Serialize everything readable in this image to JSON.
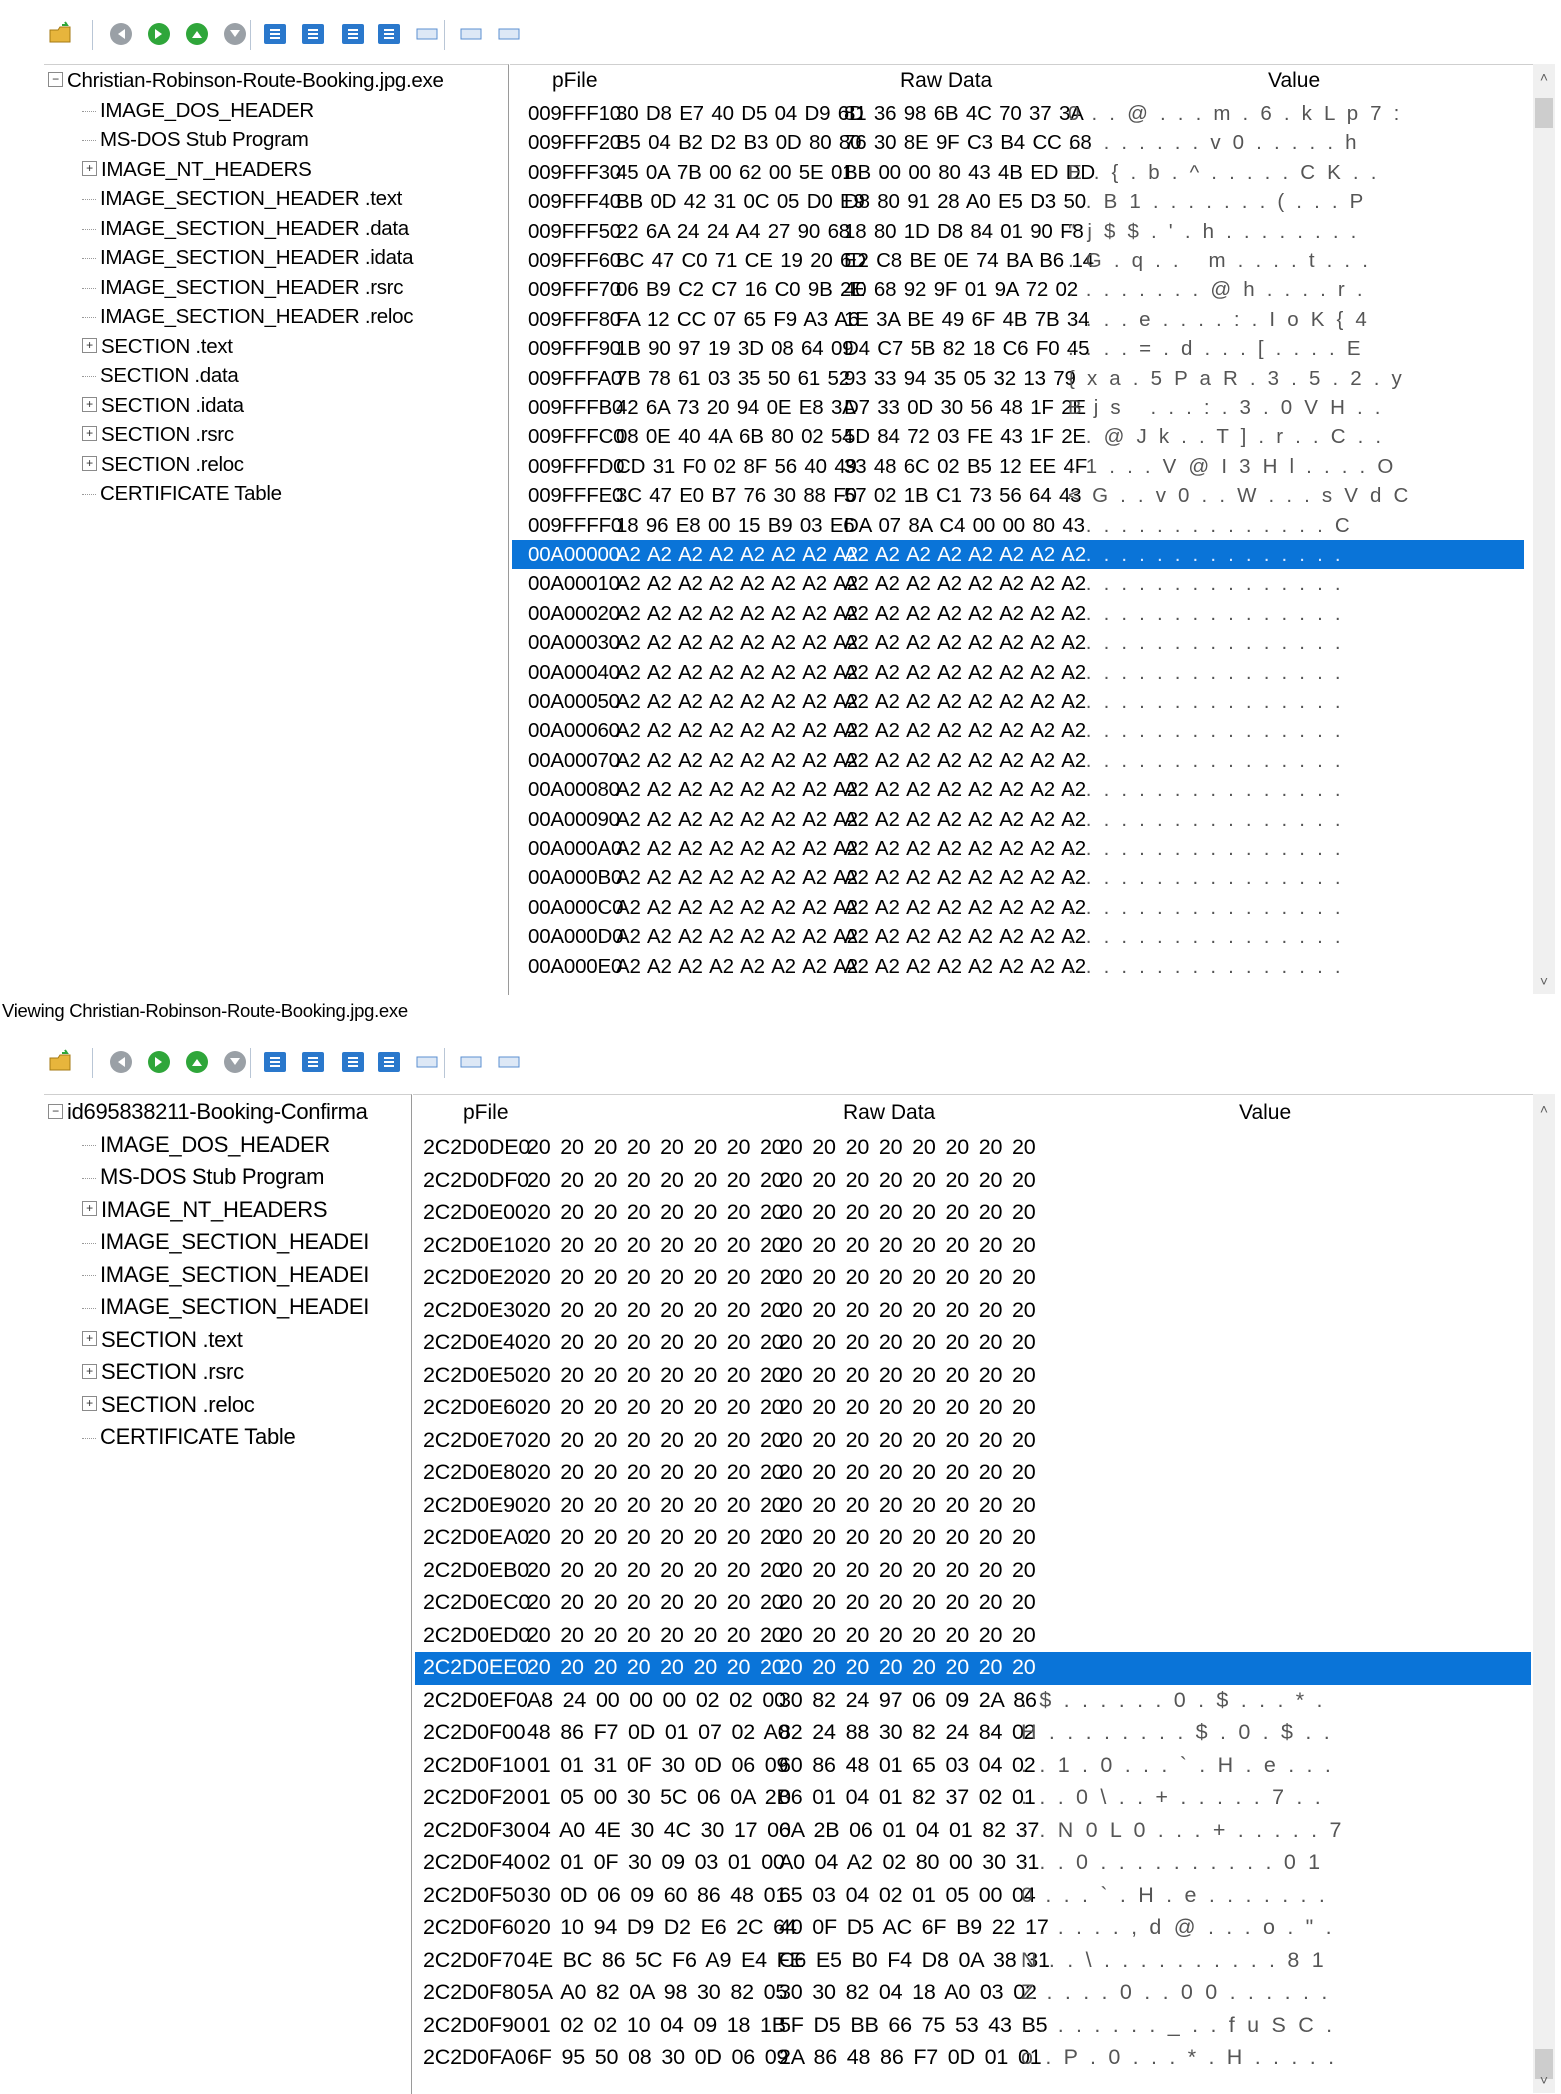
{
  "toolbar_icons": [
    {
      "name": "open-file-icon",
      "glyph": "📂"
    },
    {
      "name": "back-icon",
      "glyph": "◀"
    },
    {
      "name": "forward-icon",
      "glyph": "▶"
    },
    {
      "name": "up-icon",
      "glyph": "▲"
    },
    {
      "name": "down-icon",
      "glyph": "▼"
    },
    {
      "name": "hex-view-icon",
      "glyph": "▣"
    },
    {
      "name": "mode-icon",
      "glyph": "▤"
    },
    {
      "name": "export-icon",
      "glyph": "⇲"
    },
    {
      "name": "save-icon",
      "glyph": "⤓"
    },
    {
      "name": "view-wide-icon",
      "glyph": "▭"
    },
    {
      "name": "view-medium-icon",
      "glyph": "▭"
    },
    {
      "name": "view-narrow-icon",
      "glyph": "▭"
    }
  ],
  "colors": {
    "selection": "#0a74d8",
    "toolbar_blue": "#2a78cc",
    "toolbar_green": "#2fa63a"
  },
  "pane1": {
    "tree": [
      {
        "label": "Christian-Robinson-Route-Booking.jpg.exe",
        "expander": "−",
        "level": 0
      },
      {
        "label": "IMAGE_DOS_HEADER",
        "expander": "",
        "level": 1
      },
      {
        "label": "MS-DOS Stub Program",
        "expander": "",
        "level": 1
      },
      {
        "label": "IMAGE_NT_HEADERS",
        "expander": "+",
        "level": 1
      },
      {
        "label": "IMAGE_SECTION_HEADER .text",
        "expander": "",
        "level": 1
      },
      {
        "label": "IMAGE_SECTION_HEADER .data",
        "expander": "",
        "level": 1
      },
      {
        "label": "IMAGE_SECTION_HEADER .idata",
        "expander": "",
        "level": 1
      },
      {
        "label": "IMAGE_SECTION_HEADER .rsrc",
        "expander": "",
        "level": 1
      },
      {
        "label": "IMAGE_SECTION_HEADER .reloc",
        "expander": "",
        "level": 1
      },
      {
        "label": "SECTION .text",
        "expander": "+",
        "level": 1
      },
      {
        "label": "SECTION .data",
        "expander": "",
        "level": 1
      },
      {
        "label": "SECTION .idata",
        "expander": "+",
        "level": 1
      },
      {
        "label": "SECTION .rsrc",
        "expander": "+",
        "level": 1
      },
      {
        "label": "SECTION .reloc",
        "expander": "+",
        "level": 1
      },
      {
        "label": "CERTIFICATE Table",
        "expander": "",
        "level": 1
      }
    ],
    "headers": {
      "pfile": "pFile",
      "raw": "Raw Data",
      "value": "Value"
    },
    "rows": [
      {
        "addr": "009FFF10",
        "a": "30 D8 E7 40 D5 04 D9 6D",
        "b": "81 36 98 6B 4C 70 37 3A",
        "v": "0 . . @ . . . m . 6 . k L p 7 :"
      },
      {
        "addr": "009FFF20",
        "a": "B5 04 B2 D2 B3 0D 80 80",
        "b": "76 30 8E 9F C3 B4 CC 68",
        "v": ". . . . . . . . v 0 . . . . . h"
      },
      {
        "addr": "009FFF30",
        "a": "45 0A 7B 00 62 00 5E 01",
        "b": "BB 00 00 80 43 4B ED DD",
        "v": "E . { . b . ^ . . . . . C K . ."
      },
      {
        "addr": "009FFF40",
        "a": "BB 0D 42 31 0C 05 D0 E9",
        "b": "D8 80 91 28 A0 E5 D3 50",
        "v": ". . B 1 . . . . . . . ( . . . P"
      },
      {
        "addr": "009FFF50",
        "a": "22 6A 24 24 A4 27 90 68",
        "b": "18 80 1D D8 84 01 90 F8",
        "v": "\" j $ $ . ' . h . . . . . . . ."
      },
      {
        "addr": "009FFF60",
        "a": "BC 47 C0 71 CE 19 20 6D",
        "b": "E2 C8 BE 0E 74 BA B6 14",
        "v": ". G . q . .   m . . . . t . . ."
      },
      {
        "addr": "009FFF70",
        "a": "06 B9 C2 C7 16 C0 9B 2E",
        "b": "40 68 92 9F 01 9A 72 02",
        "v": ". . . . . . . . @ h . . . . r ."
      },
      {
        "addr": "009FFF80",
        "a": "FA 12 CC 07 65 F9 A3 A6",
        "b": "1E 3A BE 49 6F 4B 7B 34",
        "v": ". . . . e . . . . : . I o K { 4"
      },
      {
        "addr": "009FFF90",
        "a": "1B 90 97 19 3D 08 64 09",
        "b": "D4 C7 5B 82 18 C6 F0 45",
        "v": ". . . . = . d . . . [ . . . . E"
      },
      {
        "addr": "009FFFA0",
        "a": "7B 78 61 03 35 50 61 52",
        "b": "93 33 94 35 05 32 13 79",
        "v": "{ x a . 5 P a R . 3 . 5 . 2 . y"
      },
      {
        "addr": "009FFFB0",
        "a": "42 6A 73 20 94 0E E8 3A",
        "b": "D7 33 0D 30 56 48 1F 2E",
        "v": "B j s   . . . : . 3 . 0 V H . ."
      },
      {
        "addr": "009FFFC0",
        "a": "08 0E 40 4A 6B 80 02 54",
        "b": "5D 84 72 03 FE 43 1F 2E",
        "v": ". . @ J k . . T ] . r . . C . ."
      },
      {
        "addr": "009FFFD0",
        "a": "CD 31 F0 02 8F 56 40 49",
        "b": "33 48 6C 02 B5 12 EE 4F",
        "v": ". 1 . . . V @ I 3 H l . . . . O"
      },
      {
        "addr": "009FFFE0",
        "a": "3C 47 E0 B7 76 30 88 F0",
        "b": "57 02 1B C1 73 56 64 43",
        "v": "< G . . v 0 . . W . . . s V d C"
      },
      {
        "addr": "009FFFF0",
        "a": "18 96 E8 00 15 B9 03 E6",
        "b": "DA 07 8A C4 00 00 80 43",
        "v": ". . . . . . . . . . . . . . . C"
      },
      {
        "addr": "00A00000",
        "a": "A2 A2 A2 A2 A2 A2 A2 A2",
        "b": "A2 A2 A2 A2 A2 A2 A2 A2",
        "v": ". . . . . . . . . . . . . . . .",
        "selected": true
      },
      {
        "addr": "00A00010",
        "a": "A2 A2 A2 A2 A2 A2 A2 A2",
        "b": "A2 A2 A2 A2 A2 A2 A2 A2",
        "v": ". . . . . . . . . . . . . . . ."
      },
      {
        "addr": "00A00020",
        "a": "A2 A2 A2 A2 A2 A2 A2 A2",
        "b": "A2 A2 A2 A2 A2 A2 A2 A2",
        "v": ". . . . . . . . . . . . . . . ."
      },
      {
        "addr": "00A00030",
        "a": "A2 A2 A2 A2 A2 A2 A2 A2",
        "b": "A2 A2 A2 A2 A2 A2 A2 A2",
        "v": ". . . . . . . . . . . . . . . ."
      },
      {
        "addr": "00A00040",
        "a": "A2 A2 A2 A2 A2 A2 A2 A2",
        "b": "A2 A2 A2 A2 A2 A2 A2 A2",
        "v": ". . . . . . . . . . . . . . . ."
      },
      {
        "addr": "00A00050",
        "a": "A2 A2 A2 A2 A2 A2 A2 A2",
        "b": "A2 A2 A2 A2 A2 A2 A2 A2",
        "v": ". . . . . . . . . . . . . . . ."
      },
      {
        "addr": "00A00060",
        "a": "A2 A2 A2 A2 A2 A2 A2 A2",
        "b": "A2 A2 A2 A2 A2 A2 A2 A2",
        "v": ". . . . . . . . . . . . . . . ."
      },
      {
        "addr": "00A00070",
        "a": "A2 A2 A2 A2 A2 A2 A2 A2",
        "b": "A2 A2 A2 A2 A2 A2 A2 A2",
        "v": ". . . . . . . . . . . . . . . ."
      },
      {
        "addr": "00A00080",
        "a": "A2 A2 A2 A2 A2 A2 A2 A2",
        "b": "A2 A2 A2 A2 A2 A2 A2 A2",
        "v": ". . . . . . . . . . . . . . . ."
      },
      {
        "addr": "00A00090",
        "a": "A2 A2 A2 A2 A2 A2 A2 A2",
        "b": "A2 A2 A2 A2 A2 A2 A2 A2",
        "v": ". . . . . . . . . . . . . . . ."
      },
      {
        "addr": "00A000A0",
        "a": "A2 A2 A2 A2 A2 A2 A2 A2",
        "b": "A2 A2 A2 A2 A2 A2 A2 A2",
        "v": ". . . . . . . . . . . . . . . ."
      },
      {
        "addr": "00A000B0",
        "a": "A2 A2 A2 A2 A2 A2 A2 A2",
        "b": "A2 A2 A2 A2 A2 A2 A2 A2",
        "v": ". . . . . . . . . . . . . . . ."
      },
      {
        "addr": "00A000C0",
        "a": "A2 A2 A2 A2 A2 A2 A2 A2",
        "b": "A2 A2 A2 A2 A2 A2 A2 A2",
        "v": ". . . . . . . . . . . . . . . ."
      },
      {
        "addr": "00A000D0",
        "a": "A2 A2 A2 A2 A2 A2 A2 A2",
        "b": "A2 A2 A2 A2 A2 A2 A2 A2",
        "v": ". . . . . . . . . . . . . . . ."
      },
      {
        "addr": "00A000E0",
        "a": "A2 A2 A2 A2 A2 A2 A2 A2",
        "b": "A2 A2 A2 A2 A2 A2 A2 A2",
        "v": ". . . . . . . . . . . . . . . ."
      }
    ],
    "status": "Viewing Christian-Robinson-Route-Booking.jpg.exe"
  },
  "pane2": {
    "tree": [
      {
        "label": "id695838211-Booking-Confirma",
        "expander": "−",
        "level": 0
      },
      {
        "label": "IMAGE_DOS_HEADER",
        "expander": "",
        "level": 1
      },
      {
        "label": "MS-DOS Stub Program",
        "expander": "",
        "level": 1
      },
      {
        "label": "IMAGE_NT_HEADERS",
        "expander": "+",
        "level": 1
      },
      {
        "label": "IMAGE_SECTION_HEADEI",
        "expander": "",
        "level": 1
      },
      {
        "label": "IMAGE_SECTION_HEADEI",
        "expander": "",
        "level": 1
      },
      {
        "label": "IMAGE_SECTION_HEADEI",
        "expander": "",
        "level": 1
      },
      {
        "label": "SECTION .text",
        "expander": "+",
        "level": 1
      },
      {
        "label": "SECTION .rsrc",
        "expander": "+",
        "level": 1
      },
      {
        "label": "SECTION .reloc",
        "expander": "+",
        "level": 1
      },
      {
        "label": "CERTIFICATE Table",
        "expander": "",
        "level": 1
      }
    ],
    "headers": {
      "pfile": "pFile",
      "raw": "Raw Data",
      "value": "Value"
    },
    "rows": [
      {
        "addr": "2C2D0DE0",
        "a": "20 20 20 20 20 20 20 20",
        "b": "20 20 20 20 20 20 20 20",
        "v": ""
      },
      {
        "addr": "2C2D0DF0",
        "a": "20 20 20 20 20 20 20 20",
        "b": "20 20 20 20 20 20 20 20",
        "v": ""
      },
      {
        "addr": "2C2D0E00",
        "a": "20 20 20 20 20 20 20 20",
        "b": "20 20 20 20 20 20 20 20",
        "v": ""
      },
      {
        "addr": "2C2D0E10",
        "a": "20 20 20 20 20 20 20 20",
        "b": "20 20 20 20 20 20 20 20",
        "v": ""
      },
      {
        "addr": "2C2D0E20",
        "a": "20 20 20 20 20 20 20 20",
        "b": "20 20 20 20 20 20 20 20",
        "v": ""
      },
      {
        "addr": "2C2D0E30",
        "a": "20 20 20 20 20 20 20 20",
        "b": "20 20 20 20 20 20 20 20",
        "v": ""
      },
      {
        "addr": "2C2D0E40",
        "a": "20 20 20 20 20 20 20 20",
        "b": "20 20 20 20 20 20 20 20",
        "v": ""
      },
      {
        "addr": "2C2D0E50",
        "a": "20 20 20 20 20 20 20 20",
        "b": "20 20 20 20 20 20 20 20",
        "v": ""
      },
      {
        "addr": "2C2D0E60",
        "a": "20 20 20 20 20 20 20 20",
        "b": "20 20 20 20 20 20 20 20",
        "v": ""
      },
      {
        "addr": "2C2D0E70",
        "a": "20 20 20 20 20 20 20 20",
        "b": "20 20 20 20 20 20 20 20",
        "v": ""
      },
      {
        "addr": "2C2D0E80",
        "a": "20 20 20 20 20 20 20 20",
        "b": "20 20 20 20 20 20 20 20",
        "v": ""
      },
      {
        "addr": "2C2D0E90",
        "a": "20 20 20 20 20 20 20 20",
        "b": "20 20 20 20 20 20 20 20",
        "v": ""
      },
      {
        "addr": "2C2D0EA0",
        "a": "20 20 20 20 20 20 20 20",
        "b": "20 20 20 20 20 20 20 20",
        "v": ""
      },
      {
        "addr": "2C2D0EB0",
        "a": "20 20 20 20 20 20 20 20",
        "b": "20 20 20 20 20 20 20 20",
        "v": ""
      },
      {
        "addr": "2C2D0EC0",
        "a": "20 20 20 20 20 20 20 20",
        "b": "20 20 20 20 20 20 20 20",
        "v": ""
      },
      {
        "addr": "2C2D0ED0",
        "a": "20 20 20 20 20 20 20 20",
        "b": "20 20 20 20 20 20 20 20",
        "v": ""
      },
      {
        "addr": "2C2D0EE0",
        "a": "20 20 20 20 20 20 20 20",
        "b": "20 20 20 20 20 20 20 20",
        "v": "",
        "selected": true
      },
      {
        "addr": "2C2D0EF0",
        "a": "A8 24 00 00 00 02 02 00",
        "b": "30 82 24 97 06 09 2A 86",
        "v": ". $ . . . . . . 0 . $ . . . * ."
      },
      {
        "addr": "2C2D0F00",
        "a": "48 86 F7 0D 01 07 02 A0",
        "b": "82 24 88 30 82 24 84 02",
        "v": "H . . . . . . . . $ . 0 . $ . ."
      },
      {
        "addr": "2C2D0F10",
        "a": "01 01 31 0F 30 0D 06 09",
        "b": "60 86 48 01 65 03 04 02",
        "v": ". . 1 . 0 . . . ` . H . e . . ."
      },
      {
        "addr": "2C2D0F20",
        "a": "01 05 00 30 5C 06 0A 2B",
        "b": "06 01 04 01 82 37 02 01",
        "v": ". . . 0 \\ . . + . . . . . 7 . ."
      },
      {
        "addr": "2C2D0F30",
        "a": "04 A0 4E 30 4C 30 17 06",
        "b": "0A 2B 06 01 04 01 82 37",
        "v": ". . N 0 L 0 . . . + . . . . . 7"
      },
      {
        "addr": "2C2D0F40",
        "a": "02 01 0F 30 09 03 01 00",
        "b": "A0 04 A2 02 80 00 30 31",
        "v": ". . . 0 . . . . . . . . . . 0 1"
      },
      {
        "addr": "2C2D0F50",
        "a": "30 0D 06 09 60 86 48 01",
        "b": "65 03 04 02 01 05 00 04",
        "v": "0 . . . ` . H . e . . . . . . ."
      },
      {
        "addr": "2C2D0F60",
        "a": "20 10 94 D9 D2 E6 2C 64",
        "b": "40 0F D5 AC 6F B9 22 17",
        "v": "  . . . . . , d @ . . . o . \" ."
      },
      {
        "addr": "2C2D0F70",
        "a": "4E BC 86 5C F6 A9 E4 FE",
        "b": "C6 E5 B0 F4 D8 0A 38 31",
        "v": "N . . \\ . . . . . . . . . . 8 1"
      },
      {
        "addr": "2C2D0F80",
        "a": "5A A0 82 0A 98 30 82 05",
        "b": "30 30 82 04 18 A0 03 02",
        "v": "Z . . . . 0 . . 0 0 . . . . . ."
      },
      {
        "addr": "2C2D0F90",
        "a": "01 02 02 10 04 09 18 1B",
        "b": "5F D5 BB 66 75 53 43 B5",
        "v": ". . . . . . . . _ . . f u S C ."
      },
      {
        "addr": "2C2D0FA0",
        "a": "6F 95 50 08 30 0D 06 09",
        "b": "2A 86 48 86 F7 0D 01 01",
        "v": "o . P . 0 . . . * . H . . . . ."
      }
    ]
  }
}
